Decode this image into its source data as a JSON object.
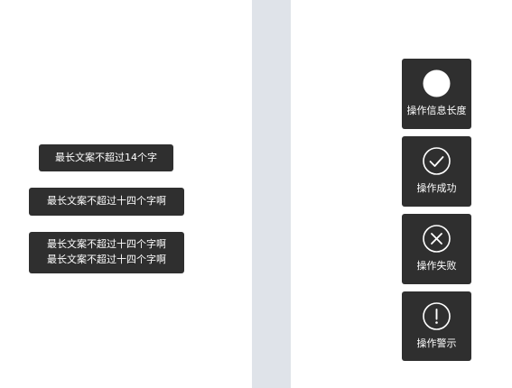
{
  "text_toasts": {
    "short": "最长文案不超过14个字",
    "medium": "最长文案不超过十四个字啊",
    "long_line_1": "最长文案不超过十四个字啊",
    "long_line_2": "最长文案不超过十四个字啊"
  },
  "icon_toasts": [
    {
      "label": "操作信息长度",
      "icon": "filled-circle-icon"
    },
    {
      "label": "操作成功",
      "icon": "check-circle-icon"
    },
    {
      "label": "操作失败",
      "icon": "close-circle-icon"
    },
    {
      "label": "操作警示",
      "icon": "exclamation-circle-icon"
    }
  ],
  "colors": {
    "toast_background": "#2f2f2f",
    "toast_text": "#ffffff",
    "divider": "#dfe3e9",
    "page_background": "#ffffff"
  }
}
